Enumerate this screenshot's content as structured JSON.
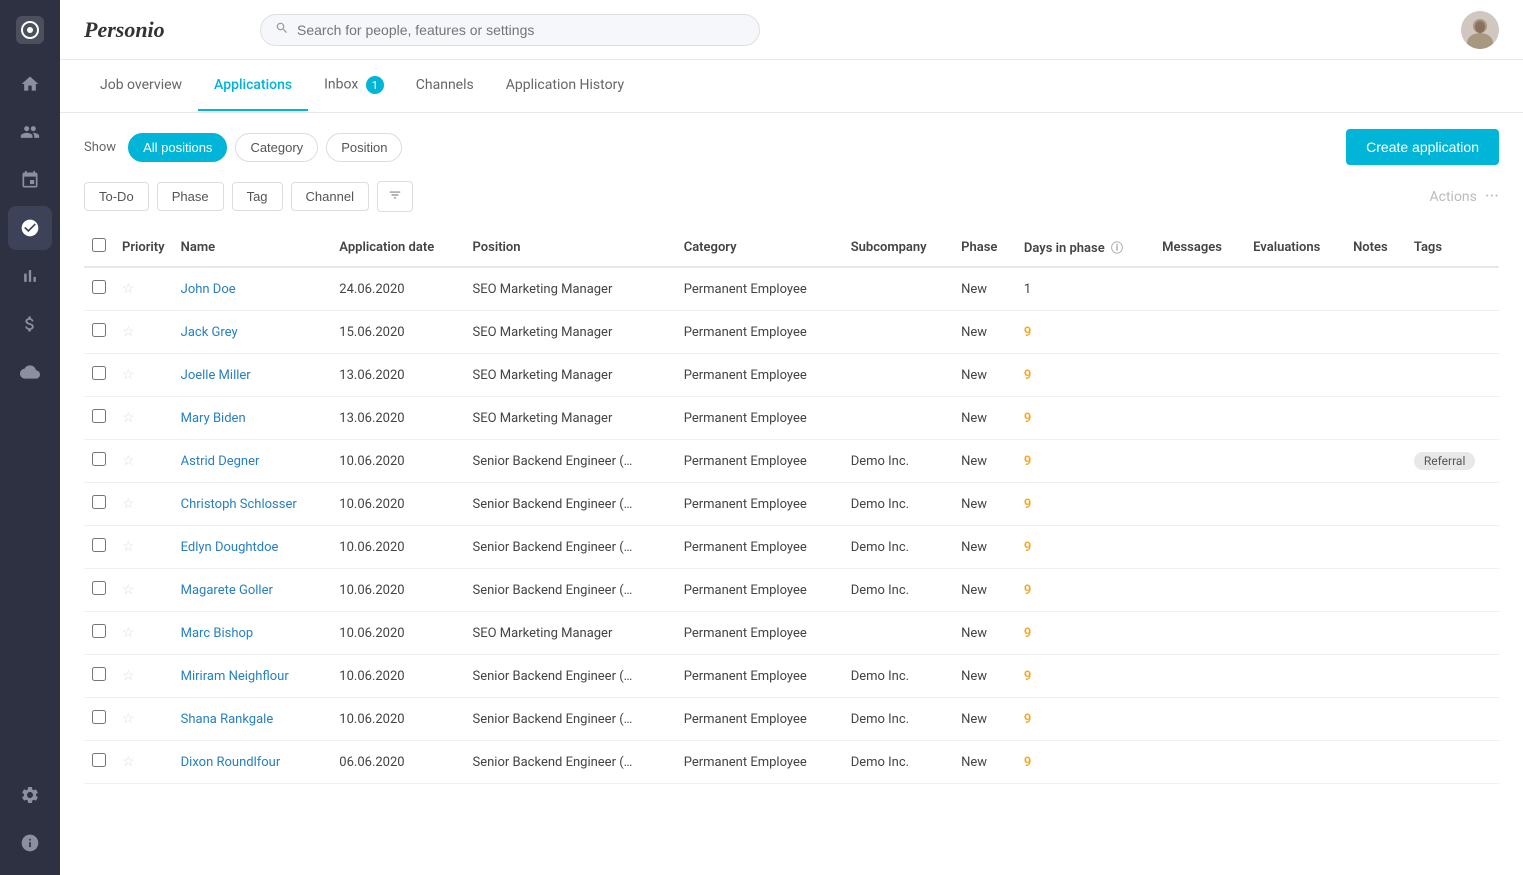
{
  "sidebar": {
    "items": [
      {
        "id": "home",
        "icon": "⊞",
        "active": false
      },
      {
        "id": "people",
        "icon": "👥",
        "active": false
      },
      {
        "id": "calendar",
        "icon": "📅",
        "active": false
      },
      {
        "id": "recruiting",
        "icon": "🎯",
        "active": true
      },
      {
        "id": "analytics",
        "icon": "📊",
        "active": false
      },
      {
        "id": "finance",
        "icon": "💰",
        "active": false
      },
      {
        "id": "integrations",
        "icon": "☁",
        "active": false
      },
      {
        "id": "settings",
        "icon": "⚙",
        "active": false
      },
      {
        "id": "info",
        "icon": "ℹ",
        "active": false
      }
    ]
  },
  "topbar": {
    "logo": "Personio",
    "search_placeholder": "Search for people, features or settings"
  },
  "tabs": [
    {
      "id": "job-overview",
      "label": "Job overview",
      "active": false,
      "badge": null
    },
    {
      "id": "applications",
      "label": "Applications",
      "active": true,
      "badge": null
    },
    {
      "id": "inbox",
      "label": "Inbox",
      "active": false,
      "badge": "1"
    },
    {
      "id": "channels",
      "label": "Channels",
      "active": false,
      "badge": null
    },
    {
      "id": "application-history",
      "label": "Application History",
      "active": false,
      "badge": null
    }
  ],
  "show_bar": {
    "label": "Show",
    "buttons": [
      {
        "id": "all-positions",
        "label": "All positions",
        "active": true
      },
      {
        "id": "category",
        "label": "Category",
        "active": false
      },
      {
        "id": "position",
        "label": "Position",
        "active": false
      }
    ],
    "create_button": "Create application"
  },
  "filter_bar": {
    "buttons": [
      {
        "id": "todo",
        "label": "To-Do"
      },
      {
        "id": "phase",
        "label": "Phase"
      },
      {
        "id": "tag",
        "label": "Tag"
      },
      {
        "id": "channel",
        "label": "Channel"
      }
    ],
    "actions_label": "Actions"
  },
  "table": {
    "columns": [
      {
        "id": "select",
        "label": ""
      },
      {
        "id": "priority",
        "label": "Priority"
      },
      {
        "id": "name",
        "label": "Name"
      },
      {
        "id": "application-date",
        "label": "Application date"
      },
      {
        "id": "position",
        "label": "Position"
      },
      {
        "id": "category",
        "label": "Category"
      },
      {
        "id": "subcompany",
        "label": "Subcompany"
      },
      {
        "id": "phase",
        "label": "Phase"
      },
      {
        "id": "days-in-phase",
        "label": "Days in phase",
        "has_info": true
      },
      {
        "id": "messages",
        "label": "Messages"
      },
      {
        "id": "evaluations",
        "label": "Evaluations"
      },
      {
        "id": "notes",
        "label": "Notes"
      },
      {
        "id": "tags",
        "label": "Tags"
      }
    ],
    "rows": [
      {
        "name": "John Doe",
        "date": "24.06.2020",
        "position": "SEO Marketing Manager",
        "category": "Permanent Employee",
        "subcompany": "",
        "phase": "New",
        "days": "1",
        "days_orange": false,
        "messages": "",
        "evaluations": "",
        "notes": "",
        "tags": ""
      },
      {
        "name": "Jack Grey",
        "date": "15.06.2020",
        "position": "SEO Marketing Manager",
        "category": "Permanent Employee",
        "subcompany": "",
        "phase": "New",
        "days": "9",
        "days_orange": true,
        "messages": "",
        "evaluations": "",
        "notes": "",
        "tags": ""
      },
      {
        "name": "Joelle Miller",
        "date": "13.06.2020",
        "position": "SEO Marketing Manager",
        "category": "Permanent Employee",
        "subcompany": "",
        "phase": "New",
        "days": "9",
        "days_orange": true,
        "messages": "",
        "evaluations": "",
        "notes": "",
        "tags": ""
      },
      {
        "name": "Mary Biden",
        "date": "13.06.2020",
        "position": "SEO Marketing Manager",
        "category": "Permanent Employee",
        "subcompany": "",
        "phase": "New",
        "days": "9",
        "days_orange": true,
        "messages": "",
        "evaluations": "",
        "notes": "",
        "tags": ""
      },
      {
        "name": "Astrid Degner",
        "date": "10.06.2020",
        "position": "Senior Backend Engineer (…",
        "category": "Permanent Employee",
        "subcompany": "Demo Inc.",
        "phase": "New",
        "days": "9",
        "days_orange": true,
        "messages": "",
        "evaluations": "",
        "notes": "",
        "tags": "Referral"
      },
      {
        "name": "Christoph Schlosser",
        "date": "10.06.2020",
        "position": "Senior Backend Engineer (…",
        "category": "Permanent Employee",
        "subcompany": "Demo Inc.",
        "phase": "New",
        "days": "9",
        "days_orange": true,
        "messages": "",
        "evaluations": "",
        "notes": "",
        "tags": ""
      },
      {
        "name": "Edlyn Doughtdoe",
        "date": "10.06.2020",
        "position": "Senior Backend Engineer (…",
        "category": "Permanent Employee",
        "subcompany": "Demo Inc.",
        "phase": "New",
        "days": "9",
        "days_orange": true,
        "messages": "",
        "evaluations": "",
        "notes": "",
        "tags": ""
      },
      {
        "name": "Magarete Goller",
        "date": "10.06.2020",
        "position": "Senior Backend Engineer (…",
        "category": "Permanent Employee",
        "subcompany": "Demo Inc.",
        "phase": "New",
        "days": "9",
        "days_orange": true,
        "messages": "",
        "evaluations": "",
        "notes": "",
        "tags": ""
      },
      {
        "name": "Marc Bishop",
        "date": "10.06.2020",
        "position": "SEO Marketing Manager",
        "category": "Permanent Employee",
        "subcompany": "",
        "phase": "New",
        "days": "9",
        "days_orange": true,
        "messages": "",
        "evaluations": "",
        "notes": "",
        "tags": ""
      },
      {
        "name": "Miriram Neighflour",
        "date": "10.06.2020",
        "position": "Senior Backend Engineer (…",
        "category": "Permanent Employee",
        "subcompany": "Demo Inc.",
        "phase": "New",
        "days": "9",
        "days_orange": true,
        "messages": "",
        "evaluations": "",
        "notes": "",
        "tags": ""
      },
      {
        "name": "Shana Rankgale",
        "date": "10.06.2020",
        "position": "Senior Backend Engineer (…",
        "category": "Permanent Employee",
        "subcompany": "Demo Inc.",
        "phase": "New",
        "days": "9",
        "days_orange": true,
        "messages": "",
        "evaluations": "",
        "notes": "",
        "tags": ""
      },
      {
        "name": "Dixon Roundlfour",
        "date": "06.06.2020",
        "position": "Senior Backend Engineer (…",
        "category": "Permanent Employee",
        "subcompany": "Demo Inc.",
        "phase": "New",
        "days": "9",
        "days_orange": true,
        "messages": "",
        "evaluations": "",
        "notes": "",
        "tags": ""
      }
    ]
  }
}
